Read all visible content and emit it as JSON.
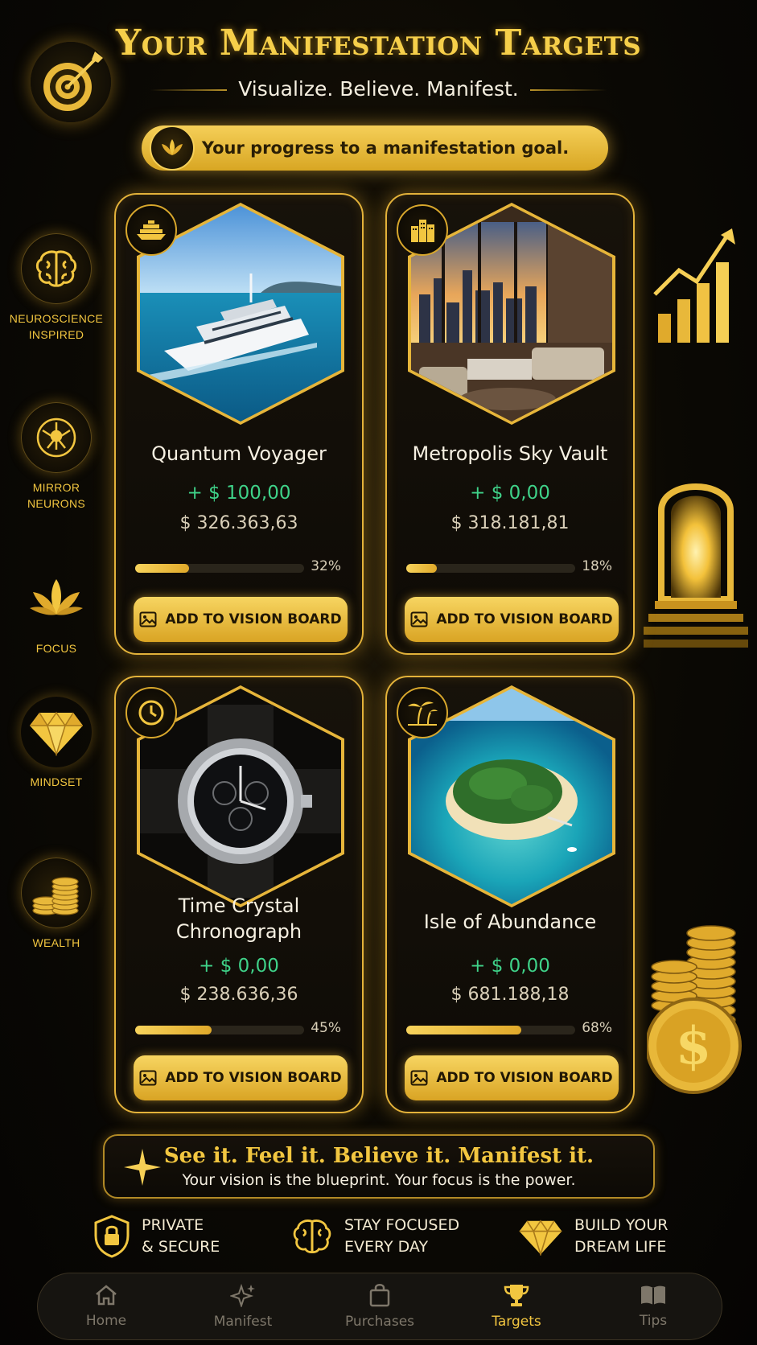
{
  "header": {
    "title": "Your Manifestation Targets",
    "subtitle": "Visualize. Believe. Manifest.",
    "progress_banner": "Your progress to a manifestation goal."
  },
  "sidebar": {
    "items": [
      {
        "label_line1": "NEUROSCIENCE",
        "label_line2": "INSPIRED",
        "icon": "brain-icon"
      },
      {
        "label_line1": "MIRROR",
        "label_line2": "NEURONS",
        "icon": "neuron-icon"
      },
      {
        "label_line1": "FOCUS",
        "label_line2": "",
        "icon": "lotus-icon"
      },
      {
        "label_line1": "MINDSET",
        "label_line2": "",
        "icon": "diamond-icon"
      },
      {
        "label_line1": "WEALTH",
        "label_line2": "",
        "icon": "coins-icon"
      }
    ]
  },
  "cards": [
    {
      "title": "Quantum Voyager",
      "plus": "+ $ 100,00",
      "amount": "$ 326.363,63",
      "progress_pct": "32%",
      "progress": 0.32,
      "button": "ADD TO VISION BOARD",
      "icon": "yacht-icon"
    },
    {
      "title": "Metropolis Sky Vault",
      "plus": "+ $ 0,00",
      "amount": "$ 318.181,81",
      "progress_pct": "18%",
      "progress": 0.18,
      "button": "ADD TO VISION BOARD",
      "icon": "building-icon"
    },
    {
      "title_line1": "Time Crystal",
      "title_line2": "Chronograph",
      "plus": "+ $ 0,00",
      "amount": "$ 238.636,36",
      "progress_pct": "45%",
      "progress": 0.45,
      "button": "ADD TO VISION BOARD",
      "icon": "clock-icon"
    },
    {
      "title": "Isle of Abundance",
      "plus": "+ $ 0,00",
      "amount": "$ 681.188,18",
      "progress_pct": "68%",
      "progress": 0.68,
      "button": "ADD TO VISION BOARD",
      "icon": "palm-icon"
    }
  ],
  "quote": {
    "main": "See it. Feel it. Believe it. Manifest it.",
    "sub": "Your vision is the blueprint. Your focus is the power."
  },
  "features": [
    {
      "line1": "PRIVATE",
      "line2": "& SECURE",
      "icon": "lock-shield-icon"
    },
    {
      "line1": "STAY FOCUSED",
      "line2": "EVERY DAY",
      "icon": "brain-icon"
    },
    {
      "line1": "BUILD YOUR",
      "line2": "DREAM LIFE",
      "icon": "diamond-icon"
    }
  ],
  "nav": {
    "items": [
      {
        "label": "Home",
        "icon": "home-icon"
      },
      {
        "label": "Manifest",
        "icon": "sparkles-icon"
      },
      {
        "label": "Purchases",
        "icon": "shopping-bag-icon"
      },
      {
        "label": "Targets",
        "icon": "trophy-icon",
        "active": true
      },
      {
        "label": "Tips",
        "icon": "book-icon"
      }
    ]
  },
  "colors": {
    "accent": "#f2c640",
    "positive": "#3fd289",
    "background": "#0b0904"
  }
}
